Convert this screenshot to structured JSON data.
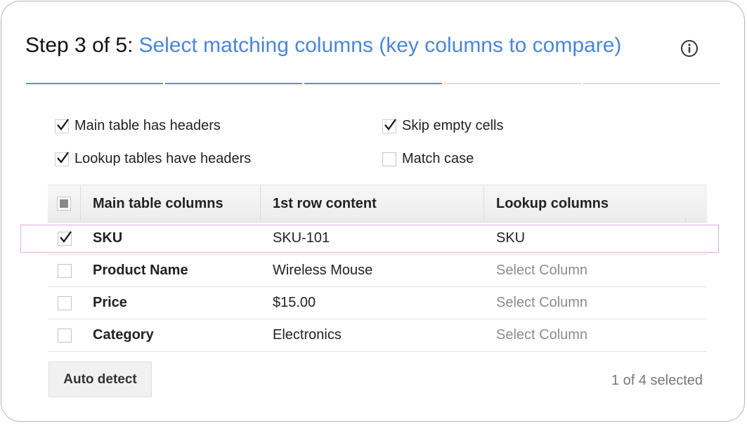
{
  "wizard": {
    "step_prefix": "Step 3 of 5:",
    "step_title": "Select matching columns (key columns to compare)",
    "info_icon": "info-circle-icon",
    "progress": {
      "total_steps": 5,
      "completed_steps": 3
    },
    "accent_color": "#4a86d8"
  },
  "options": {
    "main_headers": {
      "label": "Main table has headers",
      "checked": true
    },
    "lookup_headers": {
      "label": "Lookup tables have headers",
      "checked": true
    },
    "skip_empty": {
      "label": "Skip empty cells",
      "checked": true
    },
    "match_case": {
      "label": "Match case",
      "checked": false
    }
  },
  "table": {
    "headers": [
      "Main table columns",
      "1st row content",
      "Lookup columns"
    ],
    "header_checkbox_state": "indeterminate",
    "rows": [
      {
        "checked": true,
        "column": "SKU",
        "content": "SKU-101",
        "lookup": "SKU",
        "lookup_is_placeholder": false
      },
      {
        "checked": false,
        "column": "Product Name",
        "content": "Wireless Mouse",
        "lookup": "Select Column",
        "lookup_is_placeholder": true
      },
      {
        "checked": false,
        "column": "Price",
        "content": "$15.00",
        "lookup": "Select Column",
        "lookup_is_placeholder": true
      },
      {
        "checked": false,
        "column": "Category",
        "content": "Electronics",
        "lookup": "Select Column",
        "lookup_is_placeholder": true
      }
    ]
  },
  "footer": {
    "auto_detect_label": "Auto detect",
    "selected_count": "1 of 4 selected"
  }
}
